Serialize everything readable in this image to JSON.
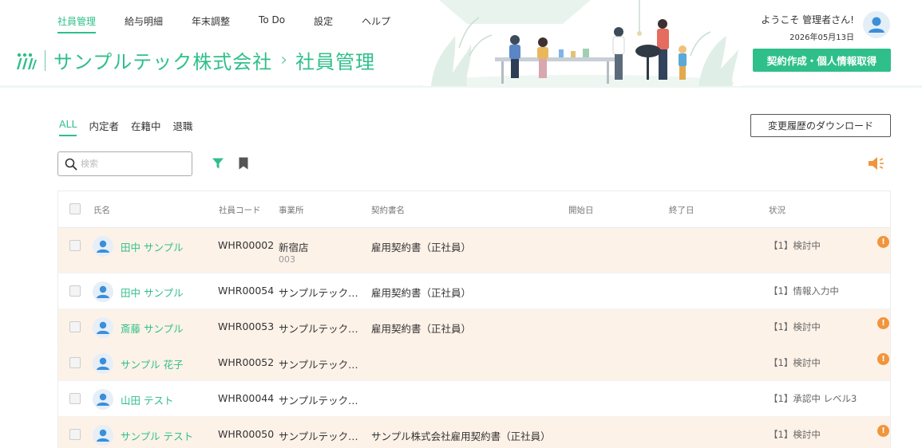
{
  "nav": {
    "items": [
      {
        "label": "社員管理",
        "active": true
      },
      {
        "label": "給与明細",
        "active": false
      },
      {
        "label": "年末調整",
        "active": false
      },
      {
        "label": "To Do",
        "active": false
      },
      {
        "label": "設定",
        "active": false
      },
      {
        "label": "ヘルプ",
        "active": false
      }
    ]
  },
  "brand": {
    "company": "サンプルテック株式会社",
    "separator": "›",
    "page": "社員管理"
  },
  "user": {
    "welcome": "ようこそ 管理者さん!",
    "date": "2026年05月13日"
  },
  "header": {
    "contract_button": "契約作成・個人情報取得"
  },
  "filters": {
    "tabs": [
      {
        "label": "ALL",
        "active": true
      },
      {
        "label": "内定者",
        "active": false
      },
      {
        "label": "在籍中",
        "active": false
      },
      {
        "label": "退職",
        "active": false
      }
    ],
    "history_button": "変更履歴のダウンロード",
    "search_placeholder": "検索"
  },
  "table": {
    "headers": {
      "name": "氏名",
      "code": "社員コード",
      "office": "事業所",
      "contract": "契約書名",
      "start": "開始日",
      "end": "終了日",
      "status": "状況"
    },
    "rows": [
      {
        "name": "田中 サンプル",
        "code": "WHR00002",
        "office": "新宿店",
        "office_sub": "003",
        "contract": "雇用契約書（正社員）",
        "status": "【1】検討中",
        "alert": true
      },
      {
        "name": "田中 サンプル",
        "code": "WHR00054",
        "office": "サンプルテック株式会社",
        "office_sub": "",
        "contract": "雇用契約書（正社員）",
        "status": "【1】情報入力中",
        "alert": false
      },
      {
        "name": "斎藤 サンプル",
        "code": "WHR00053",
        "office": "サンプルテック株式会社",
        "office_sub": "",
        "contract": "雇用契約書（正社員）",
        "status": "【1】検討中",
        "alert": true
      },
      {
        "name": "サンプル 花子",
        "code": "WHR00052",
        "office": "サンプルテック株式会社",
        "office_sub": "",
        "contract": "",
        "status": "【1】検討中",
        "alert": true
      },
      {
        "name": "山田 テスト",
        "code": "WHR00044",
        "office": "サンプルテック株式会社",
        "office_sub": "",
        "contract": "",
        "status": "【1】承認中 レベル3",
        "alert": false
      },
      {
        "name": "サンプル テスト",
        "code": "WHR00050",
        "office": "サンプルテック株式会社",
        "office_sub": "",
        "contract": "サンプル株式会社雇用契約書（正社員）",
        "status": "【1】検討中",
        "alert": true
      }
    ],
    "alert_symbol": "!"
  },
  "colors": {
    "accent": "#2fbf8a",
    "highlight_row": "#fdf2e8",
    "alert": "#f0953d"
  }
}
